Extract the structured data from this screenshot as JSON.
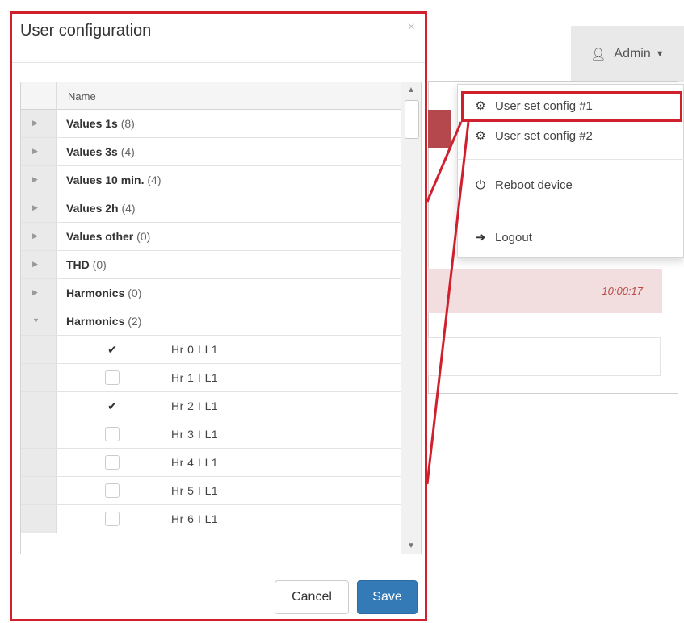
{
  "admin_menu": {
    "label": "Admin",
    "icon": "user-icon",
    "caret_icon": "caret-down-icon"
  },
  "background": {
    "timestamp": "10:00:17"
  },
  "dropdown": {
    "items": [
      {
        "label": "User set config #1",
        "icon": "gear-icon"
      },
      {
        "label": "User set config #2",
        "icon": "gear-icon"
      },
      {
        "label": "Reboot device",
        "icon": "power-icon"
      },
      {
        "label": "Logout",
        "icon": "logout-icon"
      }
    ]
  },
  "modal": {
    "title": "User configuration",
    "close_symbol": "×",
    "grid": {
      "column_header": "Name",
      "groups": [
        {
          "name": "Values 1s",
          "count": "(8)",
          "expanded": false
        },
        {
          "name": "Values 3s",
          "count": "(4)",
          "expanded": false
        },
        {
          "name": "Values 10 min.",
          "count": "(4)",
          "expanded": false
        },
        {
          "name": "Values 2h",
          "count": "(4)",
          "expanded": false
        },
        {
          "name": "Values other",
          "count": "(0)",
          "expanded": false
        },
        {
          "name": "THD",
          "count": "(0)",
          "expanded": false
        },
        {
          "name": "Harmonics",
          "count": "(0)",
          "expanded": false
        },
        {
          "name": "Harmonics",
          "count": "(2)",
          "expanded": true
        }
      ],
      "items": [
        {
          "label": "Hr 0 I L1",
          "checked": true
        },
        {
          "label": "Hr 1 I L1",
          "checked": false
        },
        {
          "label": "Hr 2 I L1",
          "checked": true
        },
        {
          "label": "Hr 3 I L1",
          "checked": false
        },
        {
          "label": "Hr 4 I L1",
          "checked": false
        },
        {
          "label": "Hr 5 I L1",
          "checked": false
        },
        {
          "label": "Hr 6 I L1",
          "checked": false
        }
      ]
    },
    "buttons": {
      "cancel": "Cancel",
      "save": "Save"
    }
  },
  "colors": {
    "highlight_red": "#d0202e",
    "primary_blue": "#337ab7",
    "error_bg": "#f2dede"
  }
}
